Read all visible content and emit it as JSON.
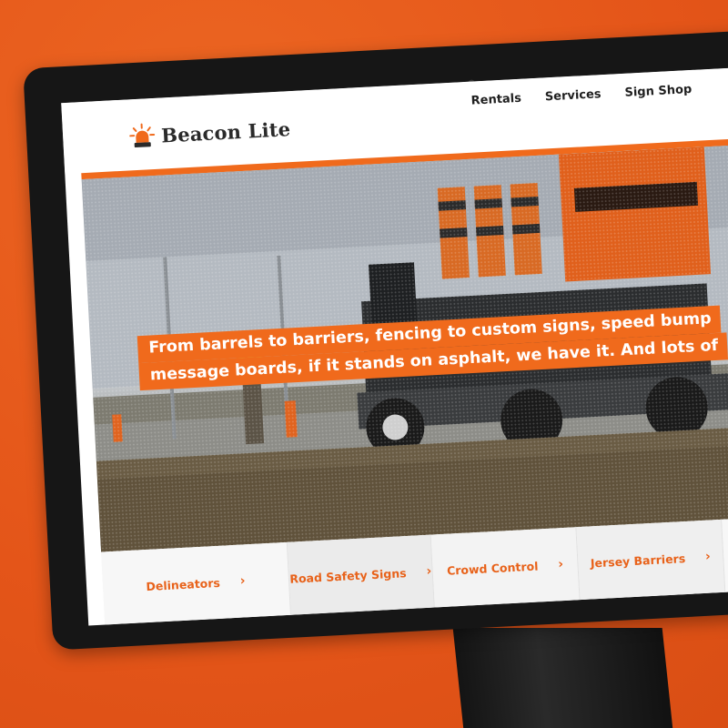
{
  "site": {
    "brand": "Beacon Lite",
    "accent_color": "#f06a1c",
    "text_color": "#1f1f1f"
  },
  "nav": {
    "items": [
      {
        "label": "Rentals"
      },
      {
        "label": "Services"
      },
      {
        "label": "Sign Shop"
      }
    ]
  },
  "hero": {
    "tagline_line1": "From barrels to barriers, fencing to custom signs, speed bump",
    "tagline_line2": "message boards, if it stands on asphalt, we have it. And lots of"
  },
  "categories": [
    {
      "label": "Delineators",
      "icon": "chevron-right-icon"
    },
    {
      "label": "Road Safety Signs",
      "icon": "chevron-right-icon"
    },
    {
      "label": "Crowd Control",
      "icon": "chevron-right-icon"
    },
    {
      "label": "Jersey Barriers",
      "icon": "chevron-right-icon"
    },
    {
      "label": "",
      "icon": ""
    }
  ]
}
